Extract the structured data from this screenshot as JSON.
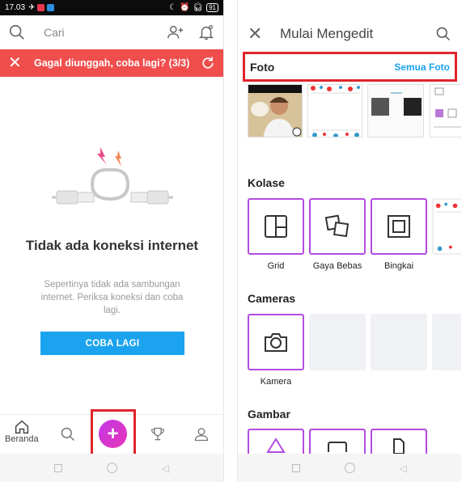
{
  "left": {
    "status": {
      "time": "17.03",
      "battery": "91"
    },
    "search": {
      "placeholder": "Cari"
    },
    "banner": {
      "message": "Gagal diunggah, coba lagi? (3/3)",
      "color": "#f04d4d"
    },
    "empty": {
      "title": "Tidak ada koneksi internet",
      "description": "Sepertinya tidak ada sambungan internet. Periksa koneksi dan coba lagi.",
      "button": "COBA LAGI"
    },
    "nav": {
      "home_label": "Beranda"
    }
  },
  "right": {
    "header": {
      "title": "Mulai Mengedit"
    },
    "foto": {
      "label": "Foto",
      "see_all": "Semua Foto"
    },
    "kolase": {
      "label": "Kolase",
      "items": [
        "Grid",
        "Gaya Bebas",
        "Bingkai"
      ]
    },
    "cameras": {
      "label": "Cameras",
      "items": [
        "Kamera"
      ]
    },
    "gambar": {
      "label": "Gambar"
    }
  },
  "colors": {
    "accent": "#1ba3ef",
    "purple": "#b34be0",
    "highlight": "#e0242c"
  }
}
